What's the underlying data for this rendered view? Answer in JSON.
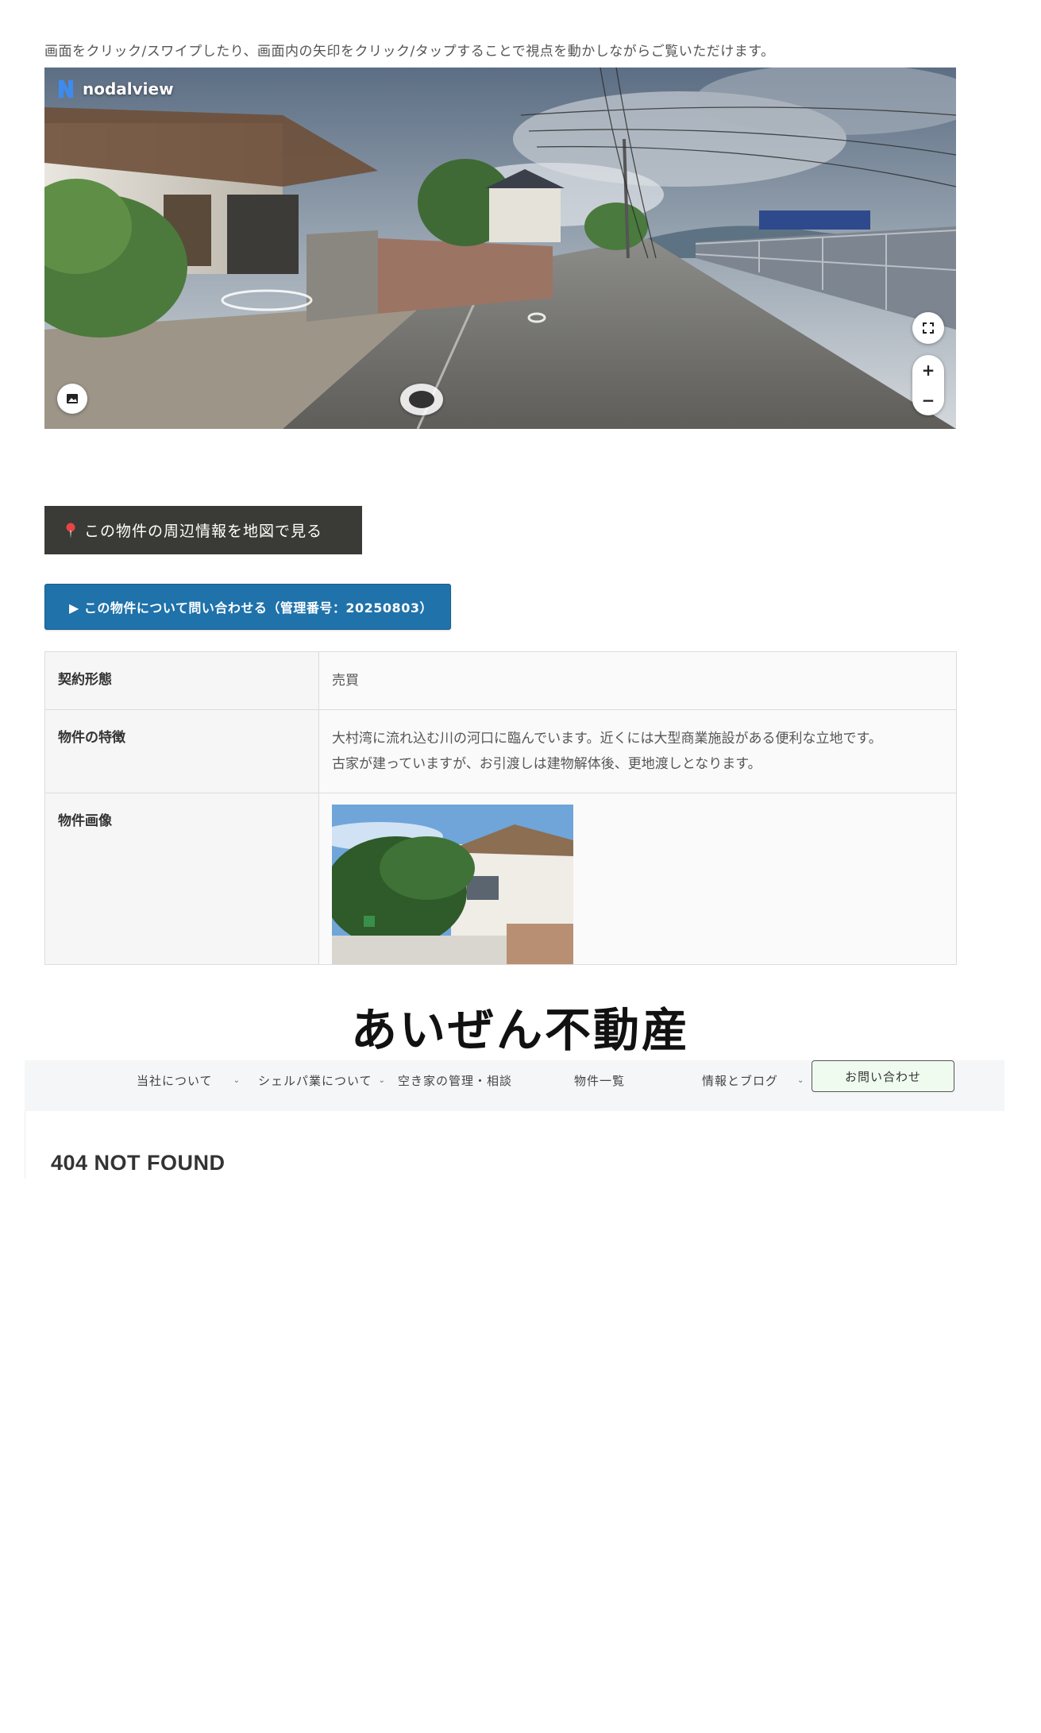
{
  "instruction": "画面をクリック/スワイプしたり、画面内の矢印をクリック/タップすることで視点を動かしながらご覧いただけます。",
  "viewer": {
    "brand": "nodalview",
    "icons": [
      "nodalview-logo-icon",
      "fullscreen-icon",
      "zoom-in-icon",
      "zoom-out-icon",
      "gallery-icon",
      "navigation-arrow-icon"
    ],
    "zoom_in": "+",
    "zoom_out": "−"
  },
  "map_button": {
    "label": "この物件の周辺情報を地図で見る"
  },
  "inquiry_button": {
    "label": "▶ この物件について問い合わせる（管理番号：20250803）"
  },
  "property": {
    "rows": [
      {
        "key": "契約形態",
        "value": "売買"
      },
      {
        "key": "物件の特徴",
        "value_line1": "大村湾に流れ込む川の河口に臨んでいます。近くには大型商業施設がある便利な立地です。",
        "value_line2": "古家が建っていますが、お引渡しは建物解体後、更地渡しとなります。"
      },
      {
        "key": "物件画像"
      }
    ]
  },
  "site": {
    "brand": "あいぜん不動産",
    "nav": [
      {
        "label": "当社について",
        "has_dropdown": true
      },
      {
        "label": "シェルパ業について",
        "has_dropdown": true
      },
      {
        "label": "空き家の管理・相談",
        "has_dropdown": false
      },
      {
        "label": "物件一覧",
        "has_dropdown": false
      },
      {
        "label": "情報とブログ",
        "has_dropdown": true
      }
    ],
    "contact_label": "お問い合わせ",
    "chevron": "⌄"
  },
  "not_found": {
    "title": "404 NOT FOUND"
  },
  "colors": {
    "map_button_bg": "#3a3b36",
    "inquiry_button_bg": "#1f72aa",
    "contact_button_bg": "#f0fbf0",
    "navbar_bg": "#f5f6f7"
  }
}
